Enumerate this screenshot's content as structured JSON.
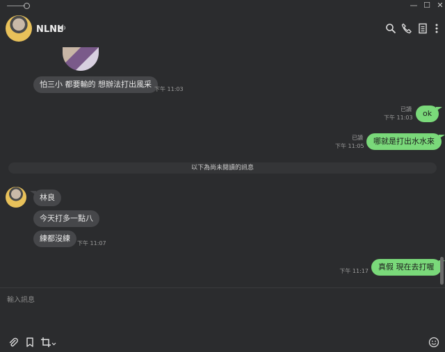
{
  "window": {
    "minimize": "—",
    "maximize": "☐",
    "close": "✕"
  },
  "header": {
    "name": "NLNL",
    "icons": [
      "speaker-icon",
      "search-icon",
      "phone-icon",
      "notes-icon",
      "more-icon"
    ]
  },
  "messages": [
    {
      "dir": "in",
      "text": "怕三小 都要輸的  想辦法打出風采",
      "time": "下午 11:03"
    },
    {
      "dir": "out",
      "text": "ok",
      "read": "已讀",
      "time": "下午 11:03"
    },
    {
      "dir": "out",
      "text": "哪就是打出水水來",
      "read": "已讀",
      "time": "下午 11:05"
    },
    {
      "dir": "in",
      "text": "林良"
    },
    {
      "dir": "in",
      "text": "今天打多一點八"
    },
    {
      "dir": "in",
      "text": "練都沒練",
      "time": "下午 11:07"
    },
    {
      "dir": "out",
      "text": "真假 現在去打喔",
      "time": "下午 11:17"
    }
  ],
  "divider": "以下為尚未閱讀的訊息",
  "composer": {
    "placeholder": "輸入訊息",
    "icons": [
      "paperclip-icon",
      "bookmark-icon",
      "crop-icon",
      "emoji-icon"
    ]
  }
}
